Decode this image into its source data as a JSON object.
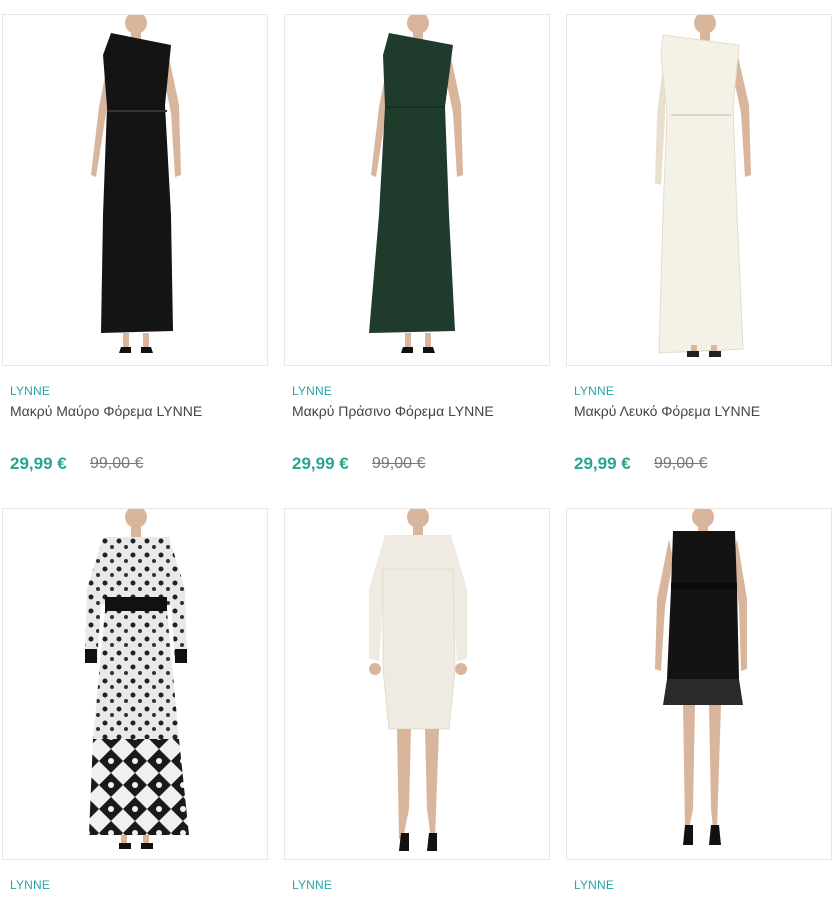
{
  "products": [
    {
      "brand": "LYNNE",
      "title": "Μακρύ Μαύρο Φόρεμα LYNNE",
      "price": "29,99 €",
      "old_price": "99,00 €",
      "dress_color": "#141414",
      "image": "black-one-shoulder-maxi-dress"
    },
    {
      "brand": "LYNNE",
      "title": "Μακρύ Πράσινο Φόρεμα LYNNE",
      "price": "29,99 €",
      "old_price": "99,00 €",
      "dress_color": "#1f3b2c",
      "image": "green-one-shoulder-maxi-dress"
    },
    {
      "brand": "LYNNE",
      "title": "Μακρύ Λευκό Φόρεμα LYNNE",
      "price": "29,99 €",
      "old_price": "99,00 €",
      "dress_color": "#f4f1e6",
      "image": "white-one-shoulder-maxi-dress"
    },
    {
      "brand": "LYNNE",
      "image": "animal-print-maxi-dress"
    },
    {
      "brand": "LYNNE",
      "image": "white-knit-midi-dress"
    },
    {
      "brand": "LYNNE",
      "image": "black-lace-mini-dress"
    }
  ],
  "colors": {
    "brand": "#2aa3a3",
    "price": "#2aa38f",
    "border": "#e6e6e6"
  }
}
